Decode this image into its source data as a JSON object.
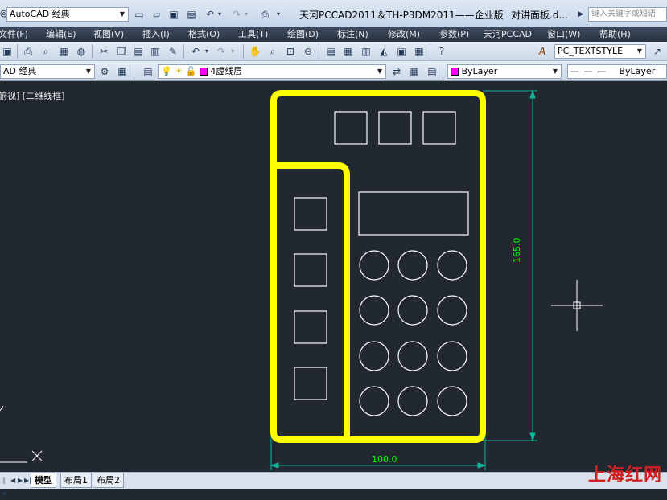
{
  "titlebar": {
    "workspace": "AutoCAD 经典",
    "title": "天河PCCAD2011＆TH-P3DM2011——企业版",
    "file": "对讲面板.d...",
    "search_placeholder": "键入关键字或短语"
  },
  "menubar": {
    "items": [
      "文件(F)",
      "编辑(E)",
      "视图(V)",
      "插入(I)",
      "格式(O)",
      "工具(T)",
      "绘图(D)",
      "标注(N)",
      "修改(M)",
      "参数(P)",
      "天河PCCAD",
      "窗口(W)",
      "帮助(H)"
    ]
  },
  "toolbar": {
    "text_style": "PC_TEXTSTYLE",
    "workspace2": "AD 经典",
    "layer": "4虚线层",
    "color": "ByLayer",
    "linetype": "ByLayer"
  },
  "viewport": {
    "label": "俯视] [二维线框]"
  },
  "drawing": {
    "dim_height": "165.0",
    "dim_width": "100.0",
    "colors": {
      "outline": "#ffff00",
      "lines": "#ffffff",
      "dim": "#00c878",
      "dim_text": "#00ff00",
      "crosshair": "#ffffff"
    }
  },
  "tabs": [
    "模型",
    "布局1",
    "布局2"
  ],
  "watermark": "上海红网"
}
